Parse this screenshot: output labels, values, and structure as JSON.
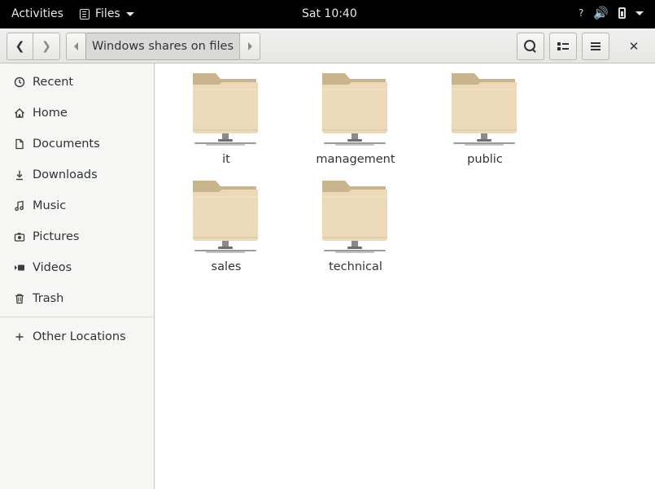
{
  "topbar": {
    "activities": "Activities",
    "app_name": "Files",
    "clock": "Sat 10:40",
    "status_icons": [
      "network-unknown-icon",
      "volume-icon",
      "battery-icon",
      "system-menu-caret-icon"
    ]
  },
  "header": {
    "back_icon": "chevron-left-icon",
    "forward_icon": "chevron-right-icon",
    "breadcrumb": "Windows shares on files",
    "search_icon": "search-icon",
    "view_icon": "list-view-icon",
    "menu_icon": "hamburger-menu-icon",
    "close_label": "✕"
  },
  "sidebar": {
    "items": [
      {
        "label": "Recent",
        "icon": "clock-icon"
      },
      {
        "label": "Home",
        "icon": "home-icon"
      },
      {
        "label": "Documents",
        "icon": "document-icon"
      },
      {
        "label": "Downloads",
        "icon": "download-icon"
      },
      {
        "label": "Music",
        "icon": "music-icon"
      },
      {
        "label": "Pictures",
        "icon": "camera-icon"
      },
      {
        "label": "Videos",
        "icon": "video-icon"
      },
      {
        "label": "Trash",
        "icon": "trash-icon"
      }
    ],
    "other_locations": {
      "label": "Other Locations",
      "icon": "plus-icon"
    }
  },
  "content": {
    "shares": [
      "it",
      "management",
      "public",
      "sales",
      "technical"
    ]
  },
  "colors": {
    "folder_body": "#ecd9b8",
    "folder_tab": "#c9b48d",
    "topbar_bg": "#000000",
    "sidebar_bg": "#f6f6f5"
  }
}
